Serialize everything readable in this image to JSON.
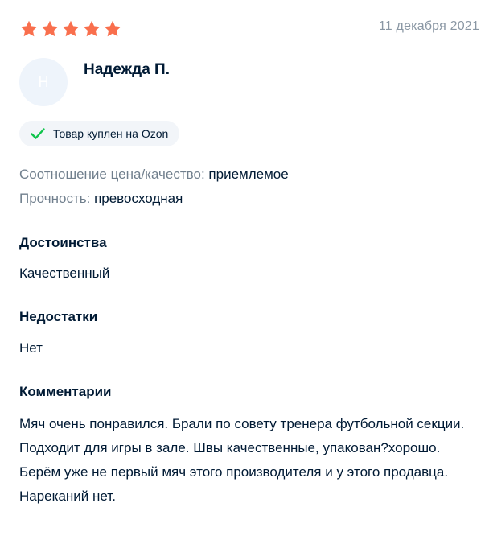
{
  "review": {
    "rating": 5,
    "rating_max": 5,
    "star_color": "#f96f4d",
    "date": "11 декабря 2021",
    "author": {
      "initial": "Н",
      "name": "Надежда П."
    },
    "badge": {
      "icon": "check-icon",
      "icon_color": "#10c44c",
      "label": "Товар куплен на Ozon"
    },
    "attributes": [
      {
        "key": "Соотношение цена/качество:",
        "value": "приемлемое"
      },
      {
        "key": "Прочность:",
        "value": "превосходная"
      }
    ],
    "pros": {
      "title": "Достоинства",
      "text": "Качественный"
    },
    "cons": {
      "title": "Недостатки",
      "text": "Нет"
    },
    "comment": {
      "title": "Комментарии",
      "text": "Мяч очень понравился. Брали по совету тренера футбольной секции. Подходит для игры в зале. Швы качественные, упакован?хорошо. Берём уже не первый мяч этого производителя и у этого продавца. Нареканий нет."
    }
  }
}
